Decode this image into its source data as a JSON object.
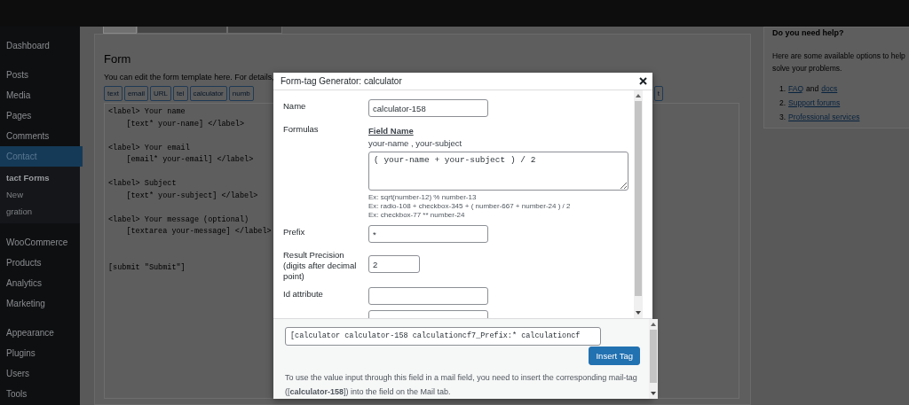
{
  "sidebar": {
    "groups": [
      [
        {
          "label": "Dashboard",
          "selected": false
        }
      ],
      [
        {
          "label": "Posts",
          "selected": false
        },
        {
          "label": "Media",
          "selected": false
        },
        {
          "label": "Pages",
          "selected": false
        },
        {
          "label": "Comments",
          "selected": false
        },
        {
          "label": "Contact",
          "selected": true,
          "children": [
            {
              "label": "tact Forms",
              "selected": true
            },
            {
              "label": "New",
              "selected": false
            },
            {
              "label": "gration",
              "selected": false
            }
          ]
        }
      ],
      [
        {
          "label": "WooCommerce",
          "selected": false
        },
        {
          "label": "Products",
          "selected": false
        },
        {
          "label": "Analytics",
          "selected": false
        },
        {
          "label": "Marketing",
          "selected": false
        }
      ],
      [
        {
          "label": "Appearance",
          "selected": false
        },
        {
          "label": "Plugins",
          "selected": false
        },
        {
          "label": "Users",
          "selected": false
        },
        {
          "label": "Tools",
          "selected": false
        }
      ]
    ]
  },
  "form": {
    "tabs": [
      {
        "selected": true
      },
      {
        "selected": false
      },
      {
        "selected": false
      }
    ],
    "heading": "Form",
    "description": "You can edit the form template here. For details,",
    "tag_buttons": [
      "text",
      "email",
      "URL",
      "tel",
      "calculator",
      "numb"
    ],
    "tag_button_right": "t",
    "template_blocks": [
      {
        "kind": "field",
        "lines": [
          "<label> Your name",
          "    [text* your-name] </label>"
        ]
      },
      {
        "kind": "field",
        "lines": [
          "<label> Your email",
          "    [email* your-email] </label>"
        ]
      },
      {
        "kind": "field",
        "lines": [
          "<label> Subject",
          "    [text* your-subject] </label>"
        ]
      },
      {
        "kind": "field",
        "lines": [
          "<label> Your message (optional)",
          "    [textarea your-message] </label>"
        ]
      },
      {
        "kind": "submit",
        "lines": [
          "[submit \"Submit\"]"
        ]
      }
    ]
  },
  "help": {
    "title": "Do you need help?",
    "text": "Here are some available options to help solve your problems.",
    "items": [
      {
        "number": "1.",
        "parts": [
          {
            "text": "FAQ",
            "link": true
          },
          {
            "text": "and",
            "link": false
          },
          {
            "text": "docs",
            "link": true
          }
        ]
      },
      {
        "number": "2.",
        "parts": [
          {
            "text": "Support forums",
            "link": true
          }
        ]
      },
      {
        "number": "3.",
        "parts": [
          {
            "text": "Professional services",
            "link": true
          }
        ]
      }
    ]
  },
  "dialog": {
    "title": "Form-tag Generator: calculator",
    "fields": [
      {
        "kind": "text",
        "label": "Name",
        "value": "calculator-158"
      },
      {
        "kind": "formula",
        "label": "Formulas",
        "heading": "Field Name",
        "field_names": "your-name , your-subject",
        "value": "( your-name + your-subject ) / 2",
        "examples": [
          "Ex: sqrt(number-12) % number-13",
          "Ex: radio-108 + checkbox-345 + ( number-667 + number-24 ) / 2",
          "Ex: checkbox-77 ** number-24"
        ]
      },
      {
        "kind": "text",
        "label": "Prefix",
        "value": "*"
      },
      {
        "kind": "number",
        "label": "Result Precision (digits after decimal point)",
        "value": "2"
      },
      {
        "kind": "text",
        "label": "Id attribute"
      },
      {
        "kind": "text"
      }
    ],
    "tag": "[calculator calculator-158 calculationcf7_Prefix:* calculationcf",
    "insert_button": "Insert Tag",
    "note": "To use the value input through this field in a mail field, you need to insert the corresponding mail-tag ([**calculator-158**]) into the field on the Mail tab."
  }
}
